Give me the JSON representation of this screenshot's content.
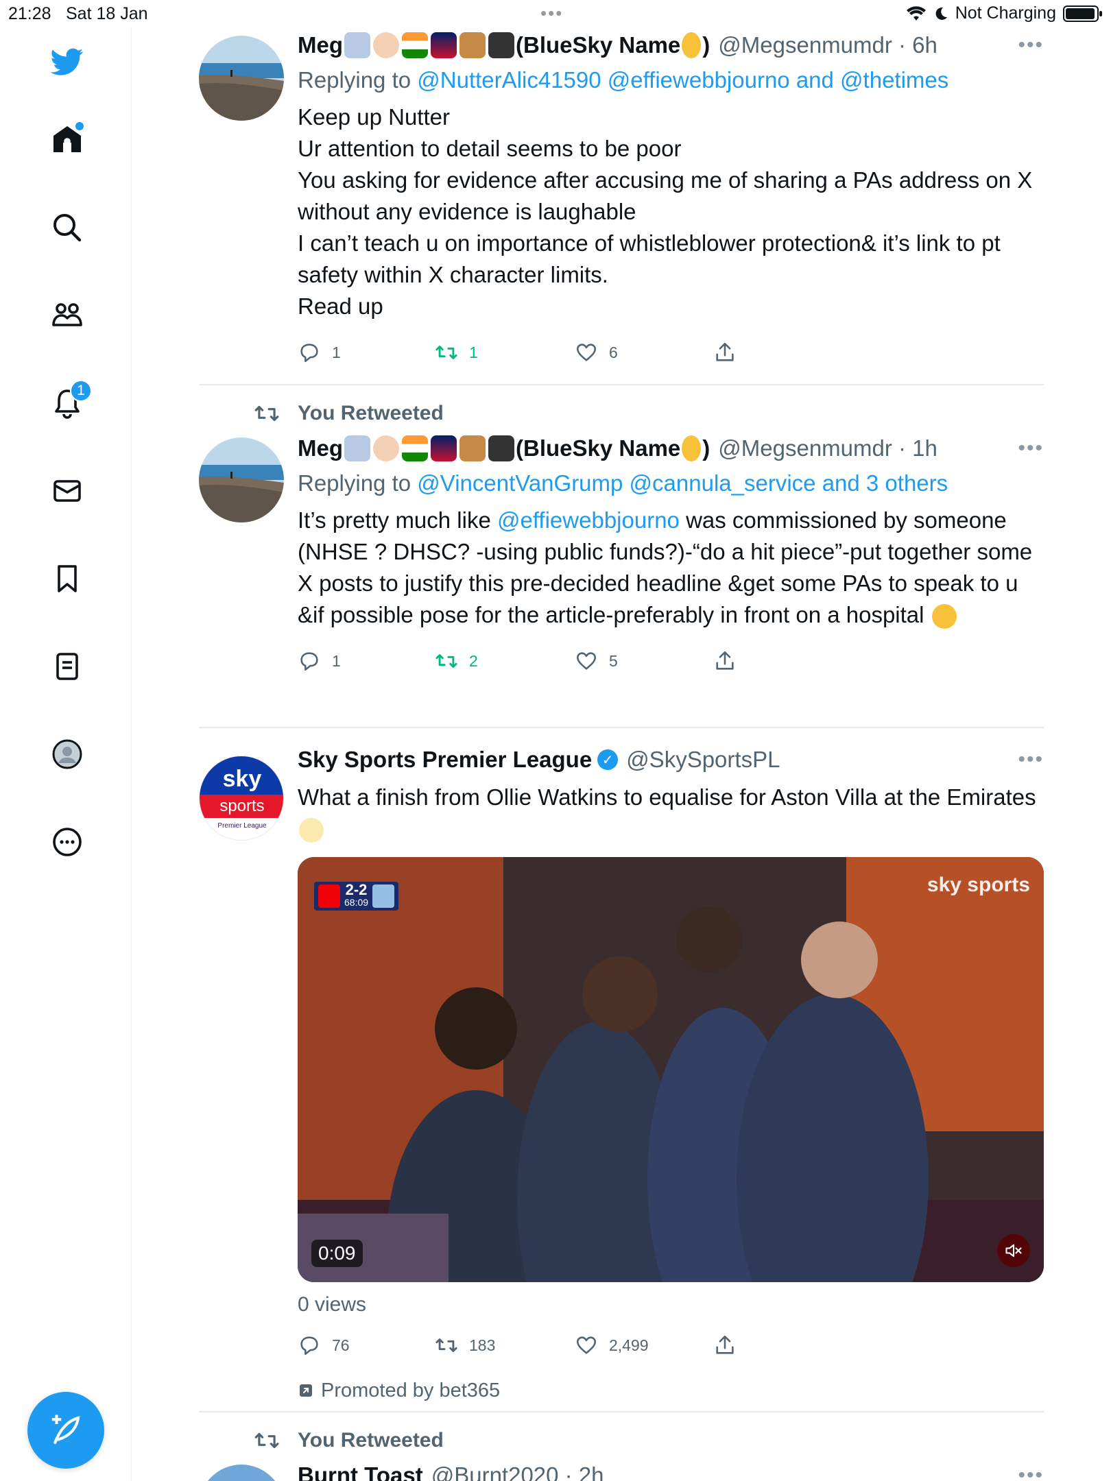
{
  "status_bar": {
    "time": "21:28",
    "date": "Sat 18 Jan",
    "battery_text": "Not Charging"
  },
  "sidebar": {
    "notifications_badge": "1",
    "accent_color": "#1d9bf0",
    "items": [
      "twitter-bird-icon",
      "home-icon",
      "search-icon",
      "communities-icon",
      "notifications-icon",
      "messages-icon",
      "bookmarks-icon",
      "lists-icon",
      "profile-icon",
      "more-icon"
    ]
  },
  "tweets": [
    {
      "name": "Meg",
      "name_suffix": "(BlueSky Name",
      "name_end": ")",
      "handle": "@Megsenmumdr · 6h",
      "replying_prefix": "Replying to",
      "replying_targets": "@NutterAlic41590 @effiewebbjourno and @thetimes",
      "body_lines": [
        "Keep up Nutter",
        "Ur attention to detail seems to be poor",
        "You asking for evidence after accusing me of sharing a PAs address on X without any evidence is laughable",
        "I can’t teach u on importance of whistleblower protection& it’s link to pt safety within X character limits.",
        "Read up"
      ],
      "replies": "1",
      "retweets": "1",
      "likes": "6"
    },
    {
      "retweeted_label": "You Retweeted",
      "name": "Meg",
      "name_suffix": "(BlueSky Name",
      "name_end": ")",
      "handle": "@Megsenmumdr · 1h",
      "replying_prefix": "Replying to",
      "replying_targets": "@VincentVanGrump @cannula_service and 3 others",
      "body_mention": "@effiewebbjourno",
      "body_before": "It’s pretty much like",
      "body_after": "was commissioned by someone (NHSE ? DHSC? -using public funds?)-“do a hit piece”-put together some X posts to justify this pre-decided headline &get some PAs to speak to u &if possible pose for the article-preferably in front on a hospital",
      "replies": "1",
      "retweets": "2",
      "likes": "5"
    },
    {
      "name": "Sky Sports Premier League",
      "handle": "@SkySportsPL",
      "body": "What a finish from Ollie Watkins to equalise for Aston Villa at the Emirates",
      "media": {
        "duration": "0:09",
        "score": "2-2",
        "match_time": "68:09",
        "watermark": "sky sports"
      },
      "avatar_text_top": "sky",
      "avatar_text_bottom": "sports",
      "avatar_text_small": "Premier League",
      "views": "0 views",
      "replies": "76",
      "retweets": "183",
      "likes": "2,499",
      "promoted": "Promoted by bet365"
    },
    {
      "retweeted_label": "You Retweeted",
      "name": "Burnt Toast",
      "handle": "@Burnt2020 · 2h"
    }
  ]
}
